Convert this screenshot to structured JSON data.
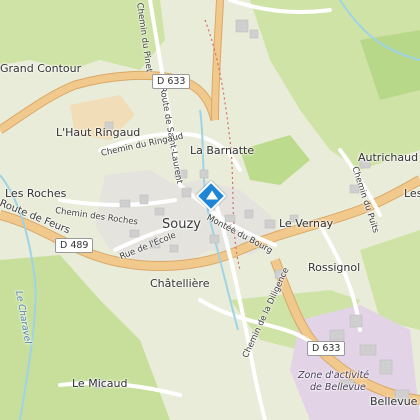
{
  "map": {
    "labels": {
      "grand_contour": "Grand Contour",
      "haut_ringaud": "L'Haut Ringaud",
      "la_barnatte": "La Barnatte",
      "autrichaud": "Autrichaud",
      "les_roches": "Les Roches",
      "souzy": "Souzy",
      "le_vernay": "Le Vernay",
      "rossignol": "Rossignol",
      "chatelliere": "Châtellière",
      "le_micaud": "Le Micaud",
      "bellevue": "Bellevue",
      "zone_bellevue": [
        "Zone d'activité",
        "de Bellevue"
      ],
      "les_partial": "Les",
      "le_charavel": "Le Charavel"
    },
    "roads": {
      "d633_top": "D 633",
      "d633_bottom": "D 633",
      "d489": "D 489",
      "route_feurs": "Route de Feurs",
      "route_st_laurent": "Route de Saint-Laurent",
      "chemin_pinet": "Chemin du Pinet",
      "chemin_ringaud": "Chemin du Ringaud",
      "chemin_roches": "Chemin des Roches",
      "rue_ecole": "Rue de l'École",
      "montee_bourg": "Montée du Bourg",
      "chemin_puits": "Chemin du Puits",
      "chemin_diligence": "Chemin de la Diligence"
    },
    "poi": {
      "icon": "diamond-location-icon",
      "color": "#1f86d6"
    },
    "colors": {
      "main_road": "#f2c98d",
      "forest": "#c7df9b",
      "water": "#9fd3e6",
      "zone": "#e2d3e6"
    }
  }
}
